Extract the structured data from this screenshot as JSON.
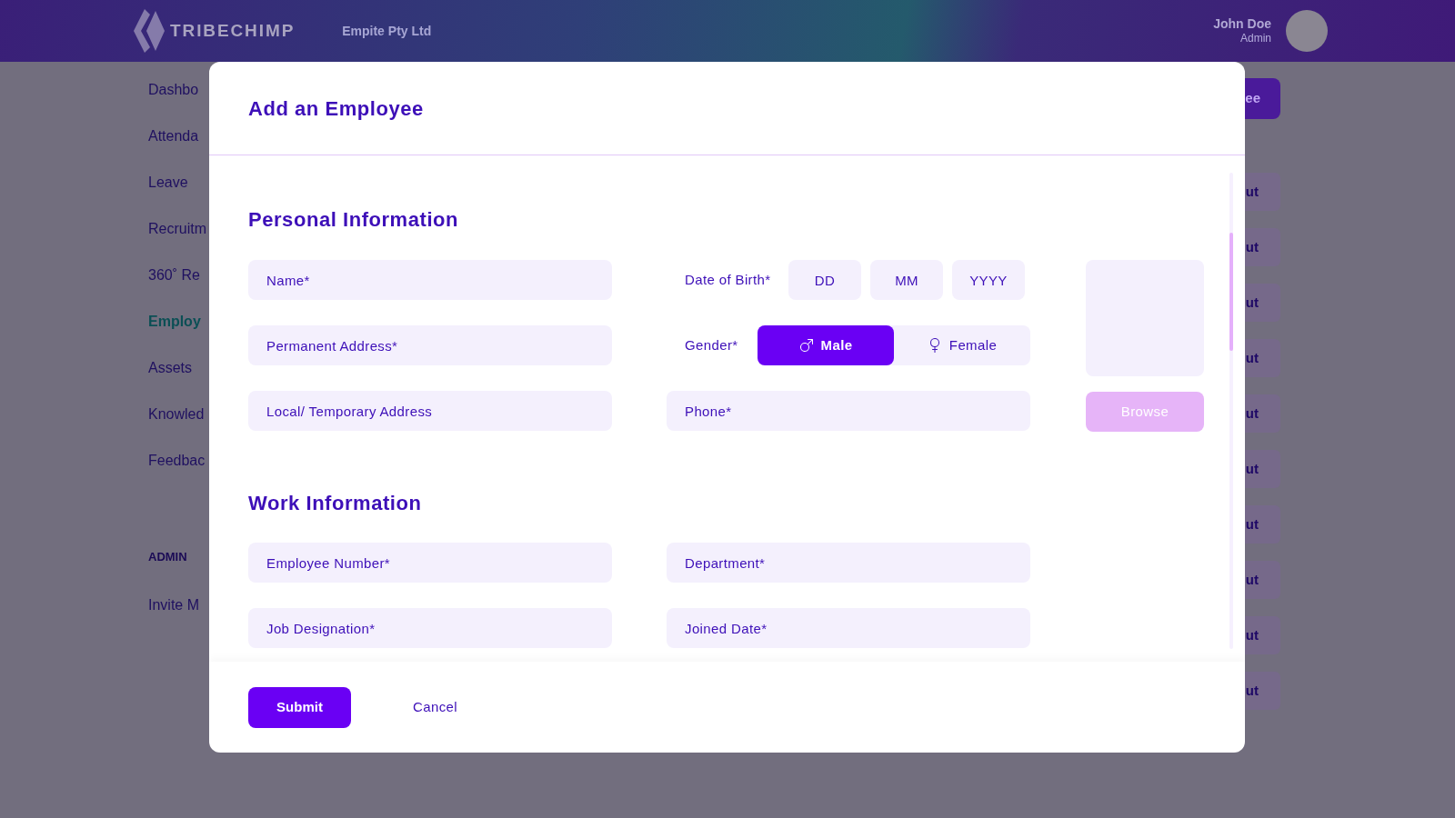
{
  "header": {
    "logo": "TRIBECHIMP",
    "company": "Empite Pty Ltd",
    "user": {
      "name": "John Doe",
      "role": "Admin"
    }
  },
  "sidebar": {
    "items": [
      {
        "label": "Dashbo",
        "selected": false
      },
      {
        "label": "Attenda",
        "selected": false
      },
      {
        "label": "Leave",
        "selected": false
      },
      {
        "label": "Recruitm",
        "selected": false
      },
      {
        "label": "360˚ Re",
        "selected": false
      },
      {
        "label": "Employ",
        "selected": true
      },
      {
        "label": "Assets",
        "selected": false
      },
      {
        "label": "Knowled",
        "selected": false
      },
      {
        "label": "Feedbac",
        "selected": false
      }
    ],
    "section_label": "ADMIN",
    "admin_items": [
      "Invite M"
    ]
  },
  "page": {
    "add_button": "ee",
    "row_buttons": [
      "ut",
      "ut",
      "ut",
      "ut",
      "ut",
      "ut",
      "ut",
      "ut",
      "ut",
      "ut"
    ]
  },
  "modal": {
    "title": "Add an Employee",
    "personal": {
      "title": "Personal Information",
      "rows": [
        [
          {
            "kind": "text",
            "placeholder": "Name*"
          },
          {
            "kind": "date",
            "label": "Date of Birth*",
            "placeholders": [
              "DD",
              "MM",
              "YYYY"
            ]
          }
        ],
        [
          {
            "kind": "text",
            "placeholder": "Permanent Address*"
          },
          {
            "kind": "choice",
            "label": "Gender*",
            "options": [
              {
                "label": "Male",
                "selected": true
              },
              {
                "label": "Female",
                "selected": false
              }
            ]
          }
        ],
        [
          {
            "kind": "text",
            "placeholder": "Local/ Temporary Address"
          },
          {
            "kind": "text",
            "placeholder": "Phone*"
          }
        ]
      ],
      "photo": {
        "button": "Browse"
      }
    },
    "work": {
      "title": "Work Information",
      "rows": [
        [
          {
            "kind": "text",
            "placeholder": "Employee Number*"
          },
          {
            "kind": "text",
            "placeholder": "Department*"
          }
        ],
        [
          {
            "kind": "text",
            "placeholder": "Job Designation*"
          },
          {
            "kind": "text",
            "placeholder": "Joined Date*"
          }
        ]
      ]
    },
    "buttons": {
      "submit": "Submit",
      "cancel": "Cancel"
    }
  }
}
